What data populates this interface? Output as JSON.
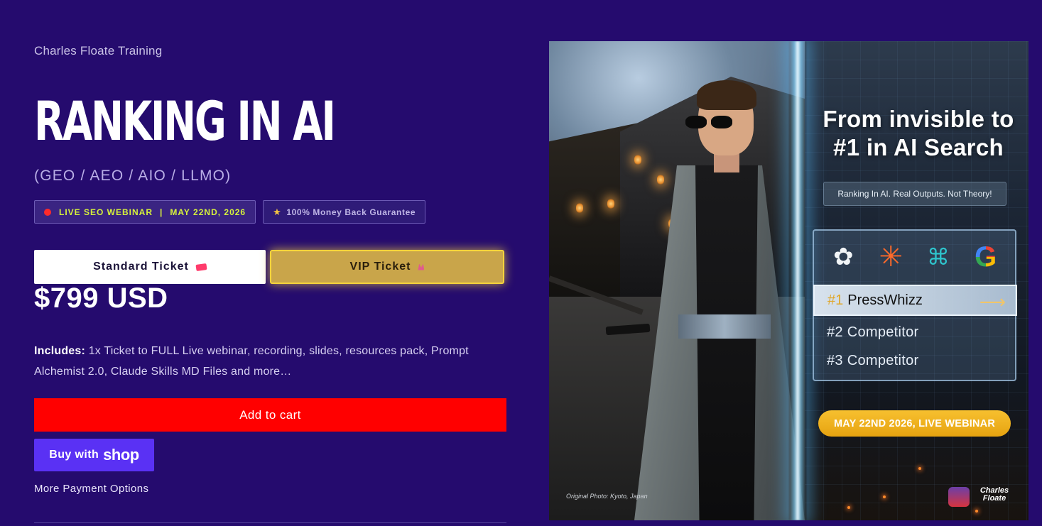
{
  "product": {
    "vendor": "Charles Floate Training",
    "title": "RANKING IN AI",
    "subtitle": "(GEO / AEO / AIO / LLMO)"
  },
  "badges": {
    "live_label": "LIVE SEO WEBINAR",
    "separator": "|",
    "date": "MAY 22ND, 2026",
    "guarantee": "100% Money Back Guarantee"
  },
  "tickets": {
    "standard_label": "Standard Ticket",
    "vip_label": "VIP Ticket",
    "selected": "VIP Ticket"
  },
  "price": "$799 USD",
  "includes": {
    "label": "Includes:",
    "text": " 1x Ticket to FULL Live webinar, recording, slides, resources pack, Prompt Alchemist 2.0, Claude Skills MD Files and more…"
  },
  "actions": {
    "add_to_cart": "Add to cart",
    "buy_with": "Buy with",
    "shop_word": "shop",
    "more_payment": "More Payment Options"
  },
  "promo_image": {
    "headline_line1": "From invisible to",
    "headline_line2": "#1 in AI Search",
    "tagline": "Ranking In AI. Real Outputs. Not Theory!",
    "rank1_num": "#1",
    "rank1_name": "PressWhizz",
    "rank2": "#2 Competitor",
    "rank3": "#3 Competitor",
    "date_banner": "MAY 22ND 2026, LIVE WEBINAR",
    "photo_credit": "Original Photo: Kyoto, Japan",
    "brand_line1": "Charles",
    "brand_line2": "Floate",
    "logos": [
      "openai-icon",
      "claude-icon",
      "perplexity-icon",
      "google-icon"
    ]
  },
  "colors": {
    "background": "#250b6e",
    "add_to_cart": "#ff0000",
    "shop_pay": "#5a31f4",
    "vip_gold": "#c9a54a",
    "live_accent": "#d6f23b"
  }
}
